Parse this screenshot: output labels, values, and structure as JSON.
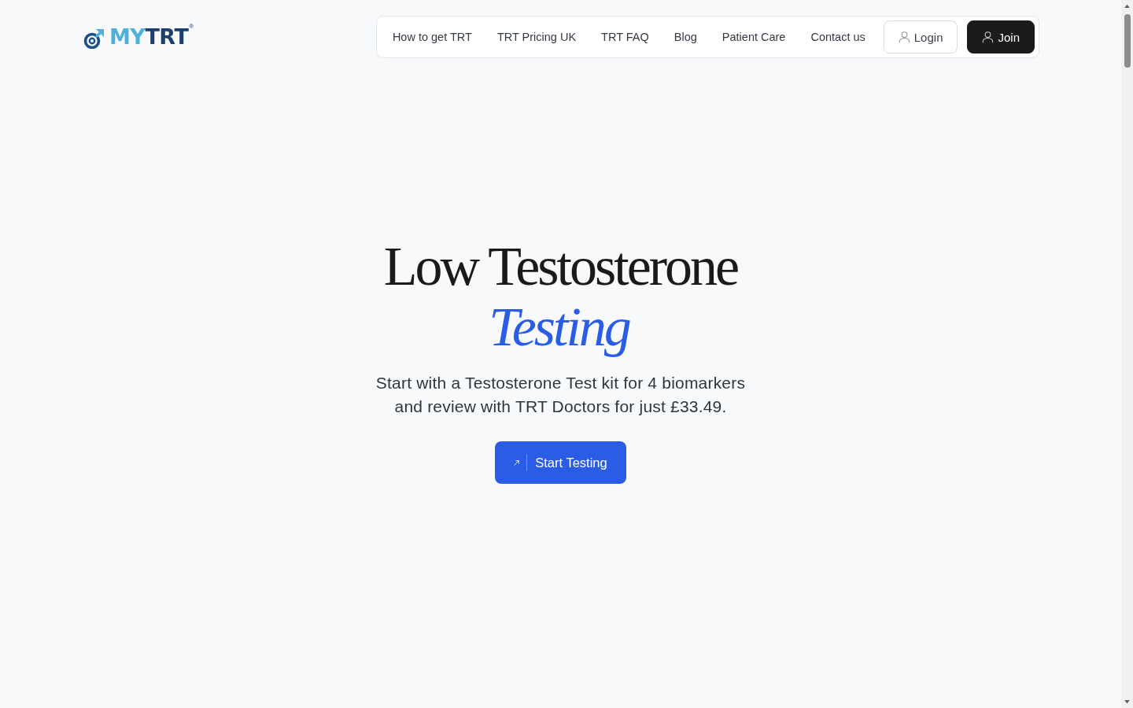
{
  "logo": {
    "wordmark": [
      {
        "text": "MY",
        "kind": "light"
      },
      {
        "text": "TRT",
        "kind": "dark"
      }
    ],
    "registered": "®"
  },
  "nav": {
    "links": [
      "How to get TRT",
      "TRT Pricing UK",
      "TRT FAQ",
      "Blog",
      "Patient Care",
      "Contact us"
    ],
    "buttons": [
      {
        "label": "Login",
        "kind": "outline"
      },
      {
        "label": "Join",
        "kind": "filled"
      }
    ]
  },
  "hero": {
    "title": "Low Testosterone",
    "title_accent": "Testing",
    "subtitle": "Start with a Testosterone Test kit for 4 biomarkers and review with TRT Doctors for just £33.49.",
    "cta": "Start Testing"
  }
}
